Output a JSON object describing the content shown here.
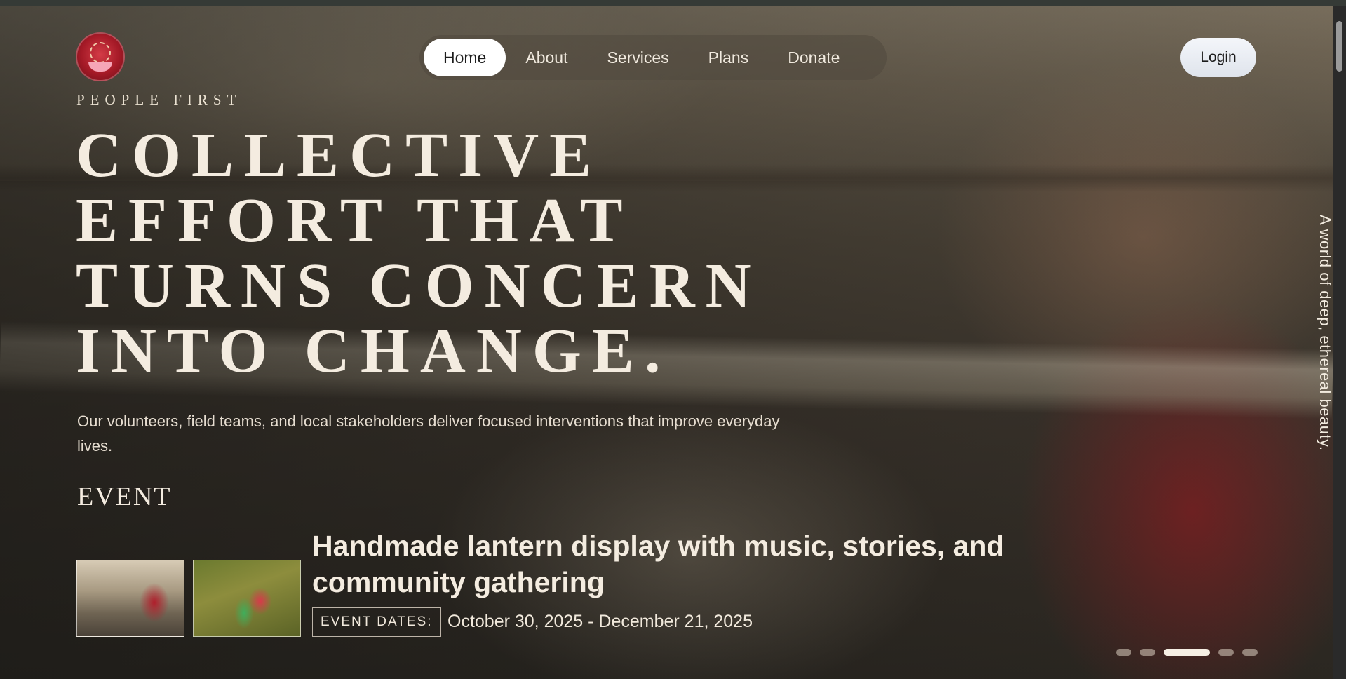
{
  "brand": {
    "name": "PEOPLE FIRST",
    "logo_icon": "hands-emblem-icon"
  },
  "nav": {
    "items": [
      {
        "label": "Home",
        "active": true
      },
      {
        "label": "About",
        "active": false
      },
      {
        "label": "Services",
        "active": false
      },
      {
        "label": "Plans",
        "active": false
      },
      {
        "label": "Donate",
        "active": false
      }
    ]
  },
  "login_label": "Login",
  "hero": {
    "headline_lines": [
      "COLLECTIVE",
      "EFFORT THAT",
      "TURNS CONCERN",
      "INTO CHANGE."
    ],
    "subtext": "Our volunteers, field teams, and local stakeholders deliver focused interventions that improve everyday lives.",
    "side_caption": "A world of deep, ethereal beauty."
  },
  "event": {
    "section_label": "EVENT",
    "title": "Handmade lantern display with music, stories, and community gathering",
    "dates_label": "EVENT DATES:",
    "dates_value": "October 30, 2025 - December 21, 2025"
  },
  "carousel": {
    "slide_count": 5,
    "active_index": 2
  },
  "colors": {
    "accent_logo": "#a51a27",
    "text_light": "#f4ece0",
    "nav_active_bg": "#ffffff"
  }
}
